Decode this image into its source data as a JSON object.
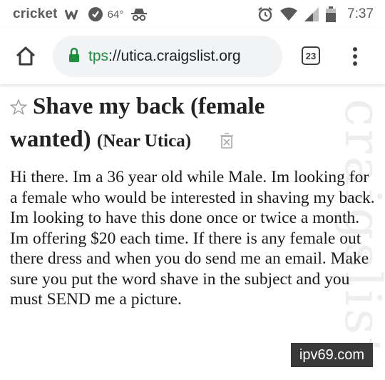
{
  "status_bar": {
    "carrier": "cricket",
    "temperature": "64°",
    "time": "7:37"
  },
  "browser": {
    "url_scheme_fragment": "tps",
    "url_rest": "://utica.craigslist.org",
    "tab_count": "23"
  },
  "post": {
    "title": "Shave my back (female wanted)",
    "location": "(Near Utica)",
    "body": "Hi there. Im a 36 year old while Male. Im looking for a female who would be interested in shaving my back. Im looking to have this done once or twice a month. Im offering $20 each time. If there is any female out there dress and when you do send me an email. Make sure you put the word shave in the subject and you must SEND me a picture."
  },
  "watermark_text": "craigslist",
  "source_badge": "ipv69.com",
  "colors": {
    "secure_green": "#1e8e3e",
    "url_pill_bg": "#f1f3f4",
    "badge_bg": "#3a3a3a"
  }
}
